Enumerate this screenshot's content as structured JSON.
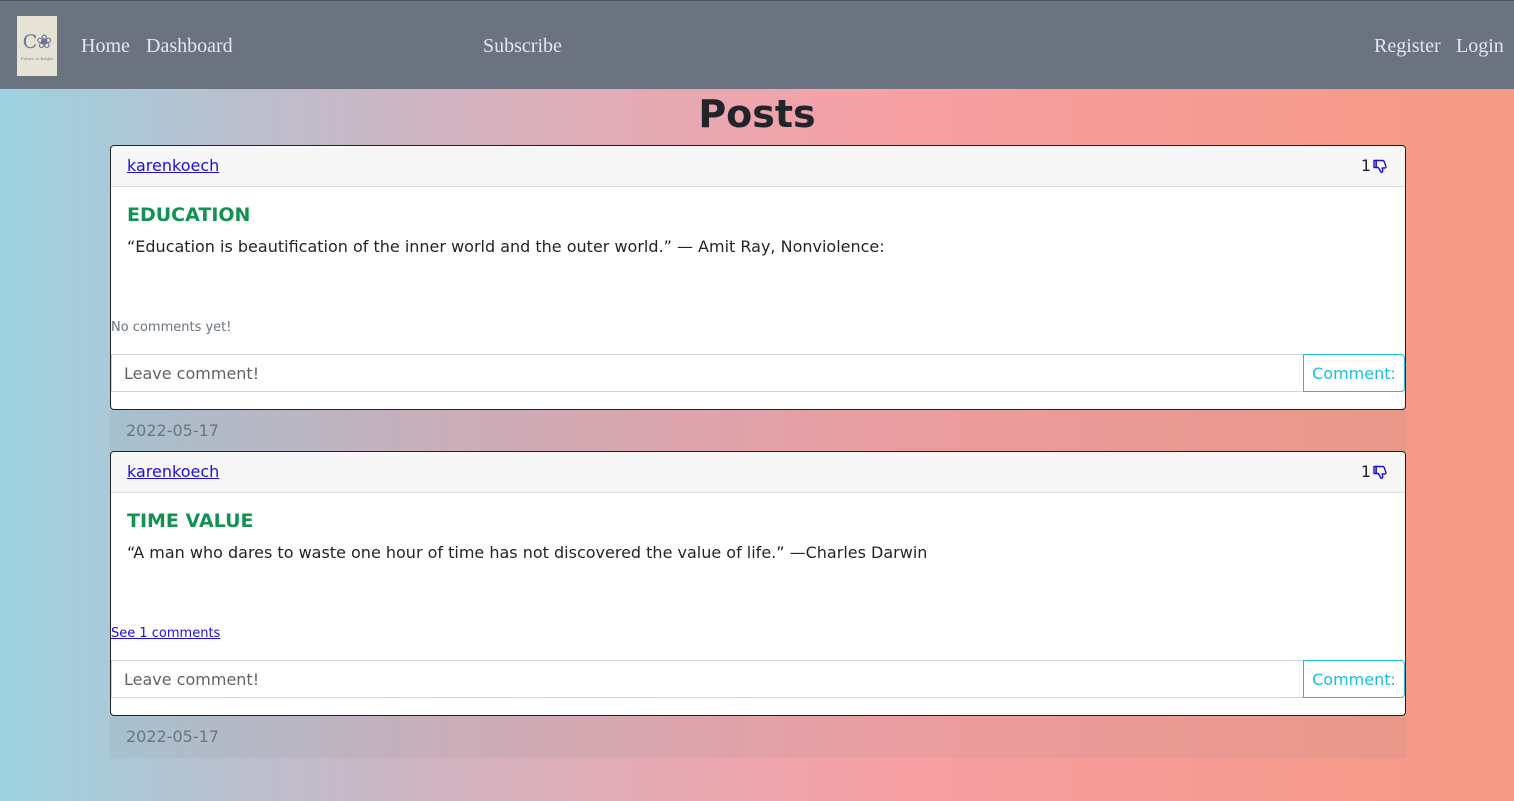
{
  "nav": {
    "logo": {
      "mark": "C❀",
      "tagline": "Future is Bright"
    },
    "home": "Home",
    "dashboard": "Dashboard",
    "subscribe": "Subscribe",
    "register": "Register",
    "login": "Login"
  },
  "page": {
    "title": "Posts"
  },
  "posts": [
    {
      "author": "karenkoech",
      "likes": "1",
      "title": "EDUCATION",
      "body": "“Education is beautification of the inner world and the outer world.” — Amit Ray, Nonviolence:",
      "comments_text": "No comments yet!",
      "comment_placeholder": "Leave comment!",
      "comment_button": "Comment:",
      "date": "2022-05-17"
    },
    {
      "author": "karenkoech",
      "likes": "1",
      "title": "TIME VALUE",
      "body": "“A man who dares to waste one hour of time has not discovered the value of life.” —Charles Darwin",
      "comments_text": "See 1 comments",
      "comment_placeholder": "Leave comment!",
      "comment_button": "Comment:",
      "date": "2022-05-17"
    }
  ],
  "icons": {
    "dislike": "thumbs-down-icon"
  },
  "colors": {
    "navbar": "#6b7280",
    "link": "#1f0fd6",
    "title_green": "#139152",
    "info": "#17bfe0"
  }
}
